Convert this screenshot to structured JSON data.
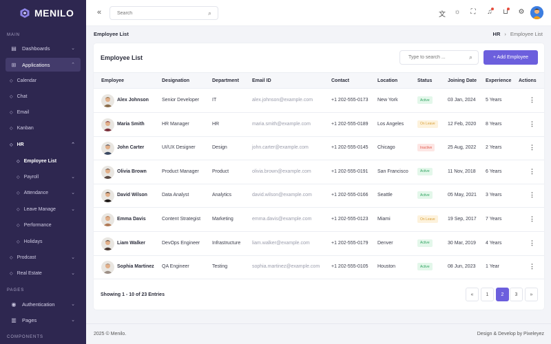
{
  "brand": {
    "name": "MENILO"
  },
  "sidebar": {
    "sections": {
      "main": "MAIN",
      "pages": "PAGES",
      "components": "COMPONENTS"
    },
    "dashboards": "Dashboards",
    "applications": "Applications",
    "calendar": "Calendar",
    "chat": "Chat",
    "email": "Email",
    "kanban": "Kanban",
    "hr": "HR",
    "employee_list": "Employee List",
    "payroll": "Payroll",
    "attendance": "Attendance",
    "leave_manage": "Leave Manage",
    "performance": "Performance",
    "holidays": "Holidays",
    "prodcast": "Prodcast",
    "real_estate": "Real Estate",
    "authentication": "Authentication",
    "pages": "Pages"
  },
  "topbar": {
    "search_placeholder": "Search"
  },
  "breadcrumb": {
    "title": "Employee List",
    "parent": "HR",
    "separator": "›",
    "current": "Employee List"
  },
  "card": {
    "title": "Employee List",
    "search_placeholder": "Type to search ...",
    "add_label": "+ Add Employee"
  },
  "table": {
    "headers": [
      "Employee",
      "Designation",
      "Department",
      "Email ID",
      "Contact",
      "Location",
      "Status",
      "Joining Date",
      "Experience",
      "Actions"
    ],
    "rows": [
      {
        "name": "Alex Johnson",
        "designation": "Senior Developer",
        "department": "IT",
        "email": "alex.johnson@example.com",
        "contact": "+1 202-555-0173",
        "location": "New York",
        "status": "Active",
        "joined": "03 Jan, 2024",
        "experience": "5 Years",
        "avatar_color": "#8a6d4b"
      },
      {
        "name": "Maria Smith",
        "designation": "HR Manager",
        "department": "HR",
        "email": "maria.smith@example.com",
        "contact": "+1 202-555-0189",
        "location": "Los Angeles",
        "status": "On Leave",
        "joined": "12 Feb, 2020",
        "experience": "8 Years",
        "avatar_color": "#7a2f3a"
      },
      {
        "name": "John Carter",
        "designation": "UI/UX Designer",
        "department": "Design",
        "email": "john.carter@example.com",
        "contact": "+1 202-555-0145",
        "location": "Chicago",
        "status": "Inactive",
        "joined": "25 Aug, 2022",
        "experience": "2 Years",
        "avatar_color": "#3b4a63"
      },
      {
        "name": "Olivia Brown",
        "designation": "Product Manager",
        "department": "Product",
        "email": "olivia.brown@example.com",
        "contact": "+1 202-555-0191",
        "location": "San Francisco",
        "status": "Active",
        "joined": "11 Nov, 2018",
        "experience": "6 Years",
        "avatar_color": "#5a4a44"
      },
      {
        "name": "David Wilson",
        "designation": "Data Analyst",
        "department": "Analytics",
        "email": "david.wilson@example.com",
        "contact": "+1 202-555-0166",
        "location": "Seattle",
        "status": "Active",
        "joined": "05 May, 2021",
        "experience": "3 Years",
        "avatar_color": "#1f1a18"
      },
      {
        "name": "Emma Davis",
        "designation": "Content Strategist",
        "department": "Marketing",
        "email": "emma.davis@example.com",
        "contact": "+1 202-555-0123",
        "location": "Miami",
        "status": "On Leave",
        "joined": "19 Sep, 2017",
        "experience": "7 Years",
        "avatar_color": "#b07a56"
      },
      {
        "name": "Liam Walker",
        "designation": "DevOps Engineer",
        "department": "Infrastructure",
        "email": "liam.walker@example.com",
        "contact": "+1 202-555-0179",
        "location": "Denver",
        "status": "Active",
        "joined": "30 Mar, 2019",
        "experience": "4 Years",
        "avatar_color": "#4a3a33"
      },
      {
        "name": "Sophia Martinez",
        "designation": "QA Engineer",
        "department": "Testing",
        "email": "sophia.martinez@example.com",
        "contact": "+1 202-555-0105",
        "location": "Houston",
        "status": "Active",
        "joined": "08 Jun, 2023",
        "experience": "1 Year",
        "avatar_color": "#9c8f86"
      }
    ]
  },
  "status_colors": {
    "Active": {
      "bg": "#e3f7ea",
      "fg": "#2fa360"
    },
    "On Leave": {
      "bg": "#fdf2dc",
      "fg": "#d9a13a"
    },
    "Inactive": {
      "bg": "#fde6e4",
      "fg": "#e0584b"
    }
  },
  "pagination": {
    "summary": "Showing 1 - 10 of 23 Entries",
    "prev": "«",
    "next": "»",
    "pages": [
      "1",
      "2",
      "3"
    ],
    "current": "2"
  },
  "footer": {
    "copyright": "2025 © Menilo.",
    "credit": "Design & Develop by Pixeleyez"
  },
  "colors": {
    "sidebar": "#2e2750",
    "accent": "#6c5fdd"
  }
}
